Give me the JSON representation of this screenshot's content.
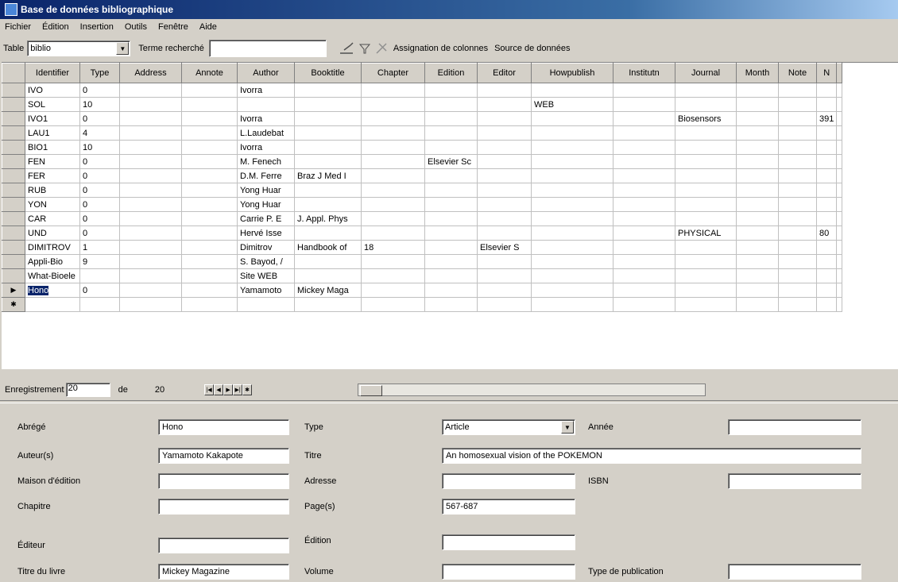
{
  "window": {
    "title": "Base de données bibliographique"
  },
  "menu": [
    "Fichier",
    "Édition",
    "Insertion",
    "Outils",
    "Fenêtre",
    "Aide"
  ],
  "toolbar": {
    "table_label": "Table",
    "table_value": "biblio",
    "search_label": "Terme recherché",
    "search_value": "",
    "column_assign": "Assignation de colonnes",
    "data_source": "Source de données"
  },
  "grid": {
    "columns": [
      "Identifier",
      "Type",
      "Address",
      "Annote",
      "Author",
      "Booktitle",
      "Chapter",
      "Edition",
      "Editor",
      "Howpublish",
      "Institutn",
      "Journal",
      "Month",
      "Note",
      "N"
    ],
    "rows": [
      [
        "IVO",
        "0",
        "",
        "",
        "Ivorra",
        "",
        "",
        "",
        "",
        "",
        "",
        "",
        "",
        "",
        ""
      ],
      [
        "SOL",
        "10",
        "",
        "",
        "",
        "",
        "",
        "",
        "",
        "WEB",
        "",
        "",
        "",
        "",
        ""
      ],
      [
        "IVO1",
        "0",
        "",
        "",
        "Ivorra",
        "",
        "",
        "",
        "",
        "",
        "",
        "Biosensors",
        "",
        "",
        "391"
      ],
      [
        "LAU1",
        "4",
        "",
        "",
        "L.Laudebat",
        "",
        "",
        "",
        "",
        "",
        "",
        "",
        "",
        "",
        ""
      ],
      [
        "BIO1",
        "10",
        "",
        "",
        "Ivorra",
        "",
        "",
        "",
        "",
        "",
        "",
        "",
        "",
        "",
        ""
      ],
      [
        "FEN",
        "0",
        "",
        "",
        "M. Fenech",
        "",
        "",
        "Elsevier Sc",
        "",
        "",
        "",
        "",
        "",
        "",
        ""
      ],
      [
        "FER",
        "0",
        "",
        "",
        "D.M. Ferre",
        "Braz J Med I",
        "",
        "",
        "",
        "",
        "",
        "",
        "",
        "",
        ""
      ],
      [
        "RUB",
        "0",
        "",
        "",
        "Yong Huar",
        "",
        "",
        "",
        "",
        "",
        "",
        "",
        "",
        "",
        ""
      ],
      [
        "YON",
        "0",
        "",
        "",
        "Yong Huar",
        "",
        "",
        "",
        "",
        "",
        "",
        "",
        "",
        "",
        ""
      ],
      [
        "CAR",
        "0",
        "",
        "",
        "Carrie P. E",
        "J. Appl. Phys",
        "",
        "",
        "",
        "",
        "",
        "",
        "",
        "",
        ""
      ],
      [
        "UND",
        "0",
        "",
        "",
        "Hervé Isse",
        "",
        "",
        "",
        "",
        "",
        "",
        "PHYSICAL",
        "",
        "",
        "80"
      ],
      [
        "DIMITROV",
        "1",
        "",
        "",
        "Dimitrov",
        "Handbook of",
        "18",
        "",
        "Elsevier S",
        "",
        "",
        "",
        "",
        "",
        ""
      ],
      [
        "Appli-Bio",
        "9",
        "",
        "",
        "S. Bayod, /",
        "",
        "",
        "",
        "",
        "",
        "",
        "",
        "",
        "",
        ""
      ],
      [
        "What-Bioele",
        "",
        "",
        "",
        "Site WEB",
        "",
        "",
        "",
        "",
        "",
        "",
        "",
        "",
        "",
        ""
      ],
      [
        "Hono",
        "0",
        "",
        "",
        "Yamamoto",
        "Mickey Maga",
        "",
        "",
        "",
        "",
        "",
        "",
        "",
        "",
        ""
      ]
    ],
    "current_row_marker": "▶",
    "new_row_marker": "✱"
  },
  "nav": {
    "record_label": "Enregistrement",
    "current": "20",
    "of_label": "de",
    "total": "20"
  },
  "form": {
    "abbrev_label": "Abrégé",
    "abbrev_value": "Hono",
    "type_label": "Type",
    "type_value": "Article",
    "year_label": "Année",
    "year_value": "",
    "authors_label": "Auteur(s)",
    "authors_value": "Yamamoto Kakapote",
    "title_label": "Titre",
    "title_value": "An homosexual vision of the POKEMON",
    "publisher_label": "Maison d'édition",
    "publisher_value": "",
    "address_label": "Adresse",
    "address_value": "",
    "isbn_label": "ISBN",
    "isbn_value": "",
    "chapter_label": "Chapitre",
    "chapter_value": "",
    "pages_label": "Page(s)",
    "pages_value": "567-687",
    "editor_label": "Éditeur",
    "editor_value": "",
    "edition_label": "Édition",
    "edition_value": "",
    "booktitle_label": "Titre du livre",
    "booktitle_value": "Mickey Magazine",
    "volume_label": "Volume",
    "volume_value": "",
    "pubtype_label": "Type de publication",
    "pubtype_value": ""
  }
}
